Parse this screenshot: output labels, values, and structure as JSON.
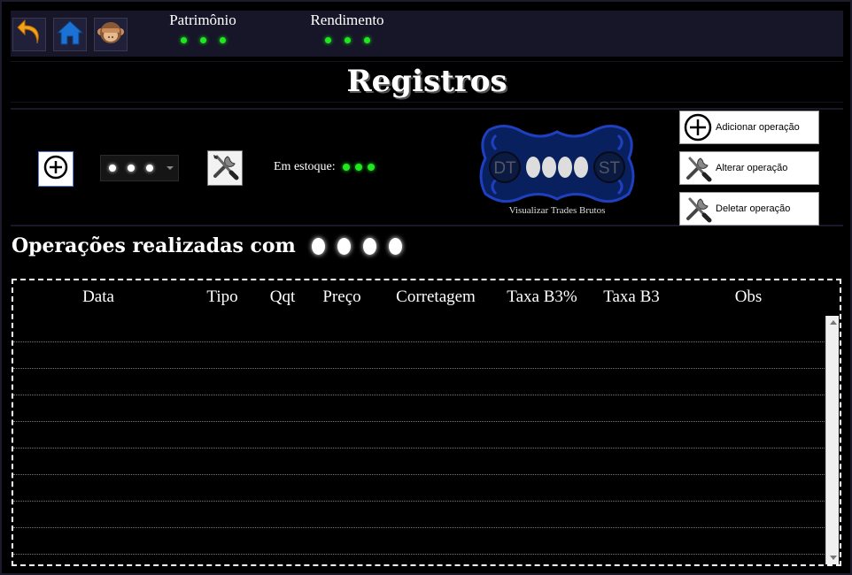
{
  "header": {
    "stats": [
      {
        "label": "Patrimônio"
      },
      {
        "label": "Rendimento"
      }
    ],
    "nav": [
      "back-arrow-icon",
      "home-icon",
      "monkey-icon"
    ]
  },
  "page": {
    "title": "Registros"
  },
  "controls": {
    "stock_label": "Em estoque:",
    "trades_caption": "Visualizar Trades Brutos",
    "trades_badge_left": "DT",
    "trades_badge_right": "ST",
    "buttons": {
      "add": "Adicionar operação",
      "edit": "Alterar operação",
      "delete": "Deletar operação"
    }
  },
  "section": {
    "title": "Operações realizadas com"
  },
  "table": {
    "columns": [
      "Data",
      "Tipo",
      "Qqt",
      "Preço",
      "Corretagem",
      "Taxa B3%",
      "Taxa B3",
      "Obs"
    ],
    "rows": [
      "",
      "",
      "",
      "",
      "",
      "",
      "",
      "",
      ""
    ]
  },
  "colors": {
    "accent_green": "#1fe81f",
    "panel": "#161628",
    "ornament_blue": "#1f3fbf"
  }
}
